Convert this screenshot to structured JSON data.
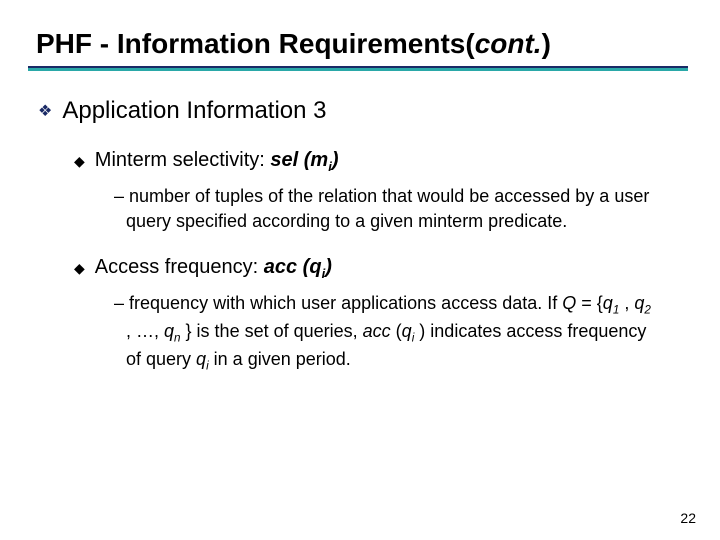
{
  "title": {
    "main": "PHF - Information Requirements(",
    "cont": "cont.",
    "tail": ")"
  },
  "lvl1": {
    "text": "Application Information 3"
  },
  "item1": {
    "label_pre": "Minterm selectivity: ",
    "sel": "sel",
    "paren_open": " (",
    "var": "m",
    "sub": "i",
    "paren_close": ")",
    "desc_dash": "– ",
    "desc": "number of tuples of the relation that would be accessed by a user query specified according to a given minterm predicate."
  },
  "item2": {
    "label_pre": "Access frequency: ",
    "acc": "acc",
    "paren_open": " (",
    "var": "q",
    "sub": "i",
    "paren_close": ")",
    "desc_dash": "– ",
    "d1": "frequency with which user applications access data. If ",
    "Q": "Q",
    "eq": " = {",
    "q1v": "q",
    "q1s": "1",
    "c1": " , ",
    "q2v": "q",
    "q2s": "2",
    "c2": " , …, ",
    "qnv": "q",
    "qns": "n",
    "c3": " } is the set of queries, ",
    "acc2": "acc",
    "po2": " (",
    "qiv": "q",
    "qis": "i",
    "pc2": " ) indicates access frequency of query ",
    "qlv": "q",
    "qls": "i",
    "tail": " in a given period."
  },
  "pagenum": "22"
}
